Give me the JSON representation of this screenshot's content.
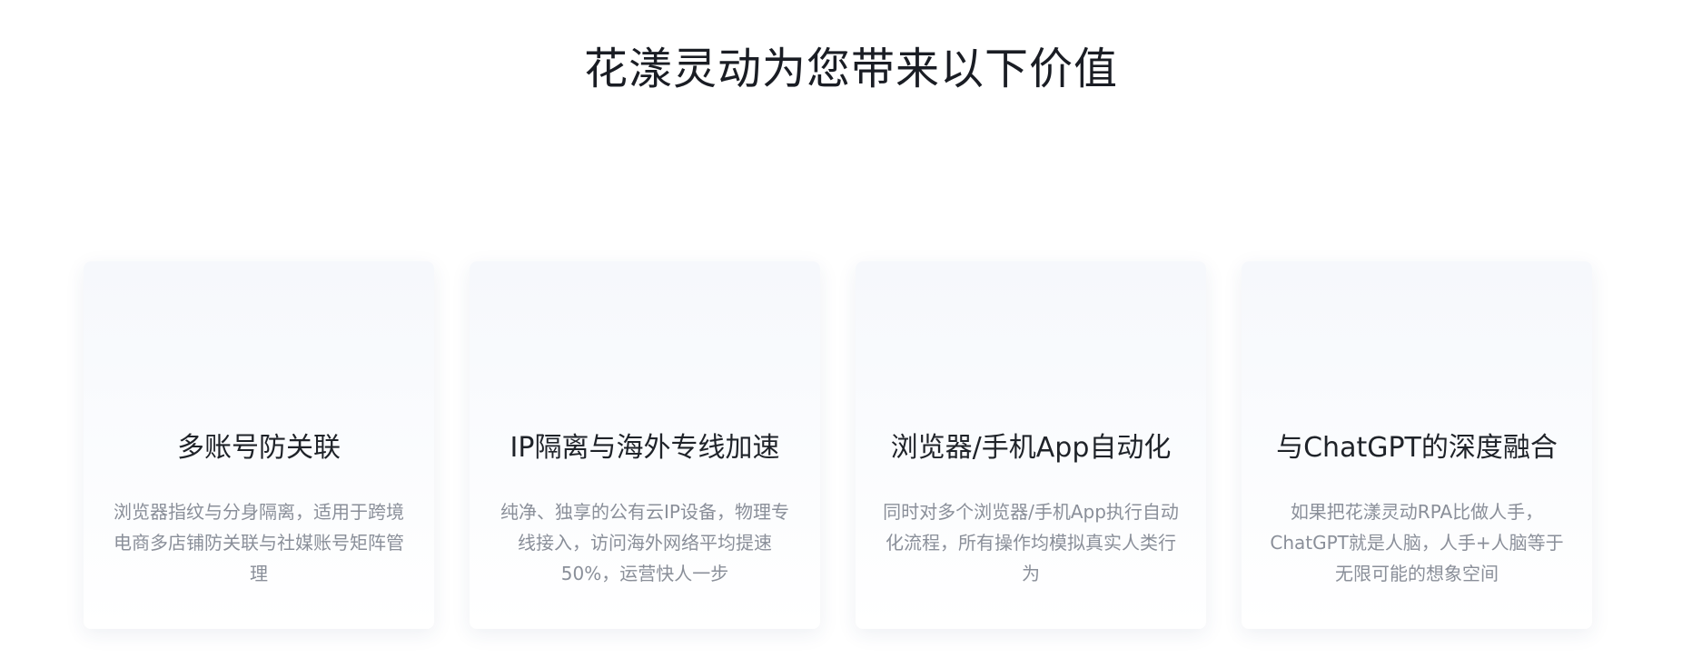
{
  "section": {
    "title": "花漾灵动为您带来以下价值"
  },
  "cards": [
    {
      "title": "多账号防关联",
      "description": "浏览器指纹与分身隔离，适用于跨境电商多店铺防关联与社媒账号矩阵管理"
    },
    {
      "title": "IP隔离与海外专线加速",
      "description": "纯净、独享的公有云IP设备，物理专线接入，访问海外网络平均提速50%，运营快人一步"
    },
    {
      "title": "浏览器/手机App自动化",
      "description": "同时对多个浏览器/手机App执行自动化流程，所有操作均模拟真实人类行为"
    },
    {
      "title": "与ChatGPT的深度融合",
      "description": "如果把花漾灵动RPA比做人手，ChatGPT就是人脑，人手+人脑等于无限可能的想象空间"
    }
  ]
}
